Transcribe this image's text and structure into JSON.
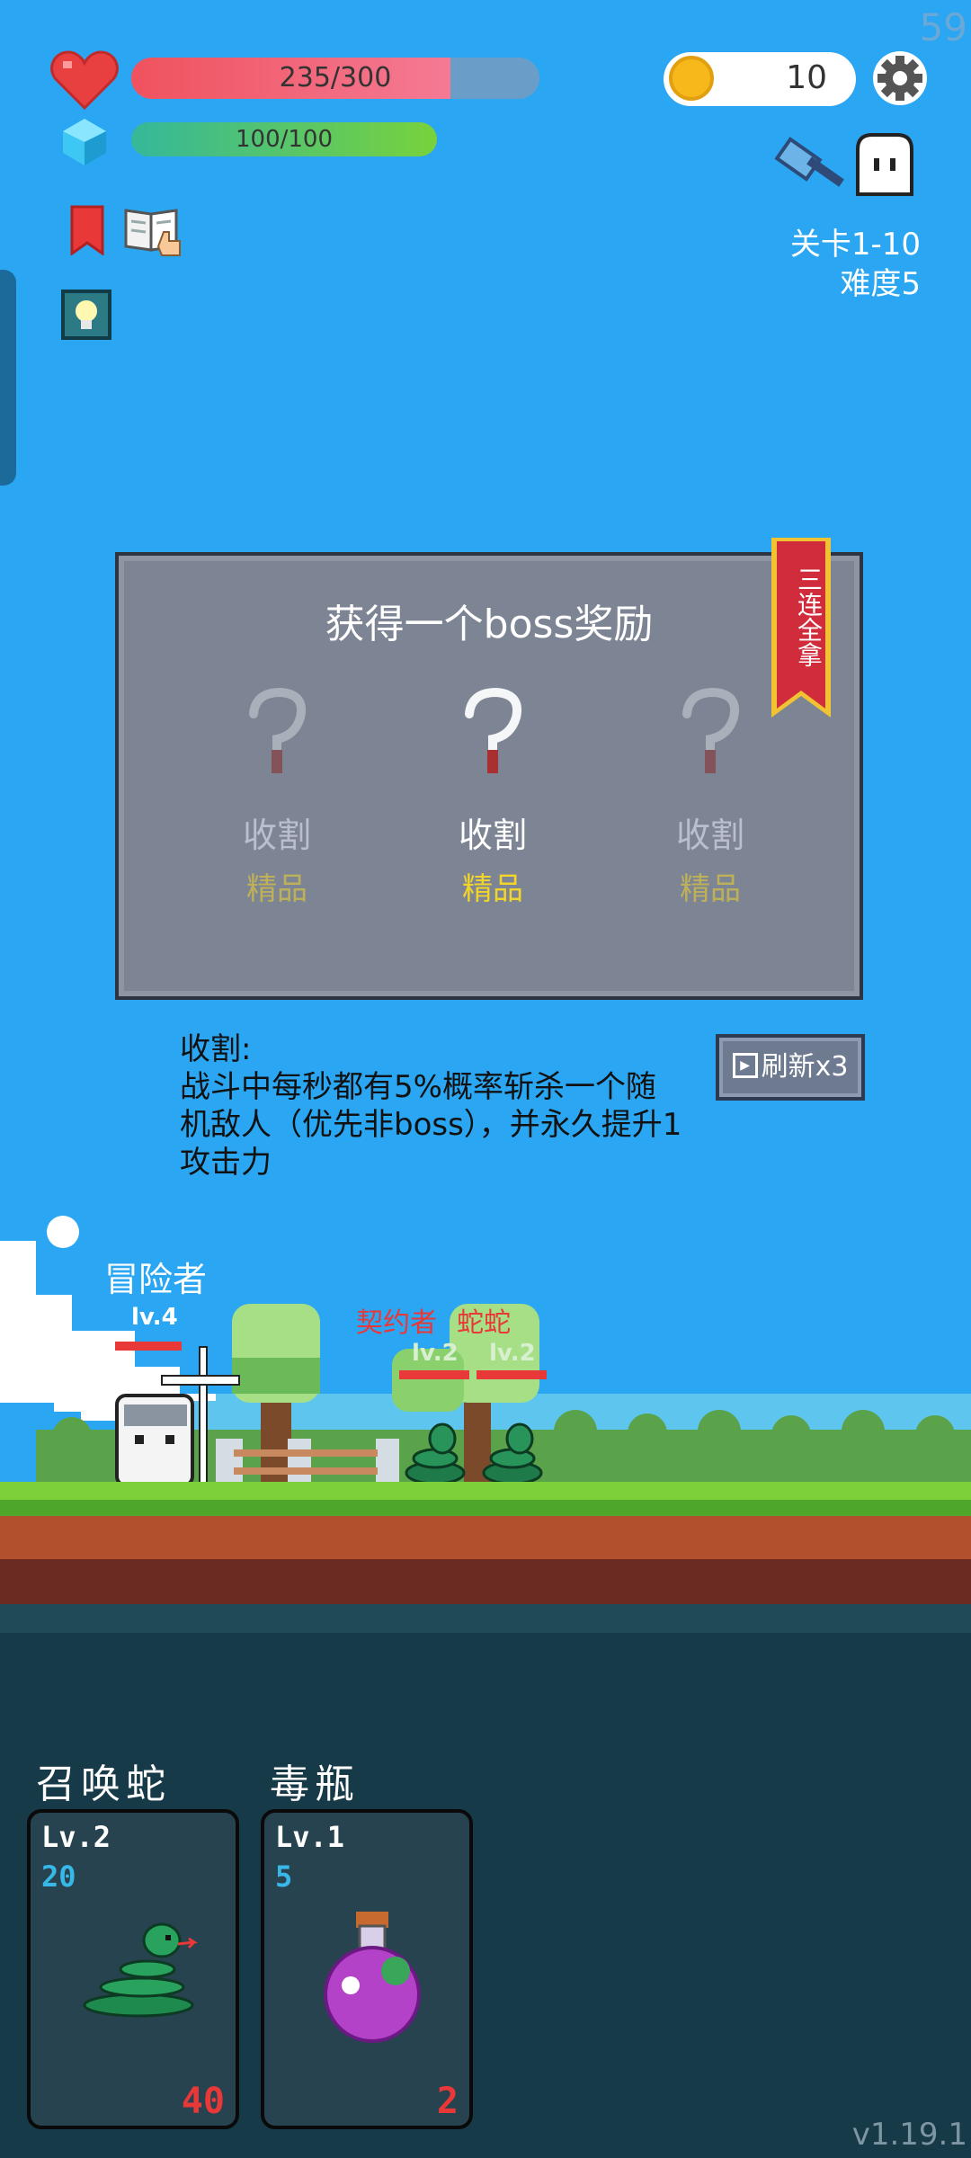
{
  "hud": {
    "fps": "59",
    "hp_text": "235/300",
    "hp_fraction": 0.783,
    "mana_text": "100/100",
    "mana_fraction": 1.0,
    "coins": "10",
    "stage": "关卡1-10",
    "difficulty": "难度5"
  },
  "reward": {
    "title": "获得一个boss奖励",
    "ribbon": "三连全拿",
    "options": [
      {
        "name": "收割",
        "quality": "精品",
        "selected": false
      },
      {
        "name": "收割",
        "quality": "精品",
        "selected": true
      },
      {
        "name": "收割",
        "quality": "精品",
        "selected": false
      }
    ],
    "desc_title": "收割:",
    "desc_body": "战斗中每秒都有5%概率斩杀一个随机敌人（优先非boss），并永久提升1攻击力",
    "refresh_label": "刷新x3"
  },
  "scene": {
    "hero": {
      "name": "冒险者",
      "level": "lv.4"
    },
    "enemies": [
      {
        "name": "契约者",
        "level": "lv.2"
      },
      {
        "name": "蛇蛇",
        "level": "lv.2"
      }
    ]
  },
  "skills": [
    {
      "name": "召唤蛇",
      "level": "Lv.2",
      "cost": "20",
      "count": "40"
    },
    {
      "name": "毒瓶",
      "level": "Lv.1",
      "cost": "5",
      "count": "2"
    }
  ],
  "version": "v1.19.1",
  "colors": {
    "hp": "#f0525e",
    "mana": "#3cc88a",
    "sky": "#2aa6f2",
    "quality": "#f2d42a"
  }
}
